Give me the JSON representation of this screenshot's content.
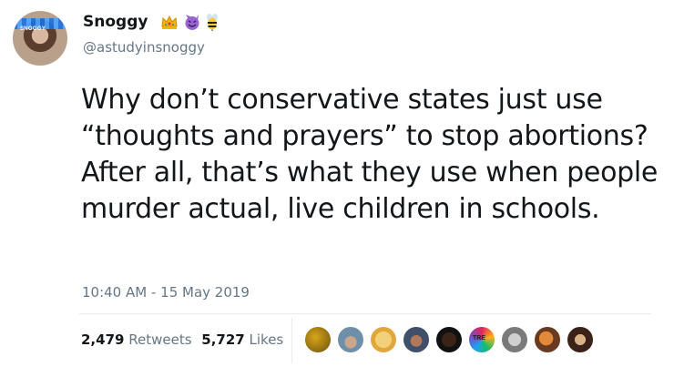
{
  "user": {
    "display_name": "Snoggy",
    "handle": "@astudyinsnoggy",
    "avatar_text": "SNOGGY",
    "badges": [
      "crown-emoji",
      "smiling-devil-emoji",
      "bee-emoji"
    ]
  },
  "tweet": {
    "text": "Why don’t conservative states just use “thoughts and prayers” to stop abortions? After all, that’s what they use when people murder actual, live children in schools.",
    "timestamp": "10:40 AM - 15 May 2019"
  },
  "stats": {
    "retweets_count": "2,479",
    "retweets_label": "Retweets",
    "likes_count": "5,727",
    "likes_label": "Likes"
  },
  "liker_avatars": [
    {
      "icon": "liker-avatar",
      "text": ""
    },
    {
      "icon": "liker-avatar",
      "text": ""
    },
    {
      "icon": "liker-avatar",
      "text": ""
    },
    {
      "icon": "liker-avatar",
      "text": ""
    },
    {
      "icon": "liker-avatar",
      "text": ""
    },
    {
      "icon": "liker-avatar",
      "text": "TRE"
    },
    {
      "icon": "liker-avatar",
      "text": ""
    },
    {
      "icon": "liker-avatar",
      "text": ""
    },
    {
      "icon": "liker-avatar",
      "text": ""
    }
  ],
  "colors": {
    "text_primary": "#14171a",
    "text_secondary": "#657786",
    "divider": "#e6ecf0"
  }
}
